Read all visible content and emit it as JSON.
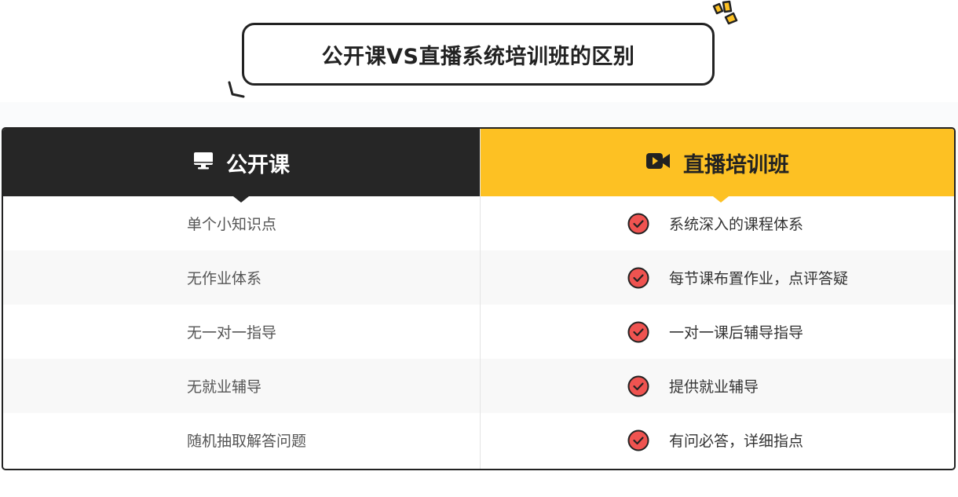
{
  "title": "公开课VS直播系统培训班的区别",
  "colors": {
    "dark": "#262626",
    "accent": "#fdc123",
    "check": "#ef5350",
    "border": "#222222"
  },
  "left_column": {
    "header_icon": "monitor-icon",
    "header_label": "公开课",
    "items": [
      "单个小知识点",
      "无作业体系",
      "无一对一指导",
      "无就业辅导",
      "随机抽取解答问题"
    ]
  },
  "right_column": {
    "header_icon": "video-camera-icon",
    "header_label": "直播培训班",
    "item_icon": "check-circle-icon",
    "items": [
      "系统深入的课程体系",
      "每节课布置作业，点评答疑",
      "一对一课后辅导指导",
      "提供就业辅导",
      "有问必答，详细指点"
    ]
  }
}
